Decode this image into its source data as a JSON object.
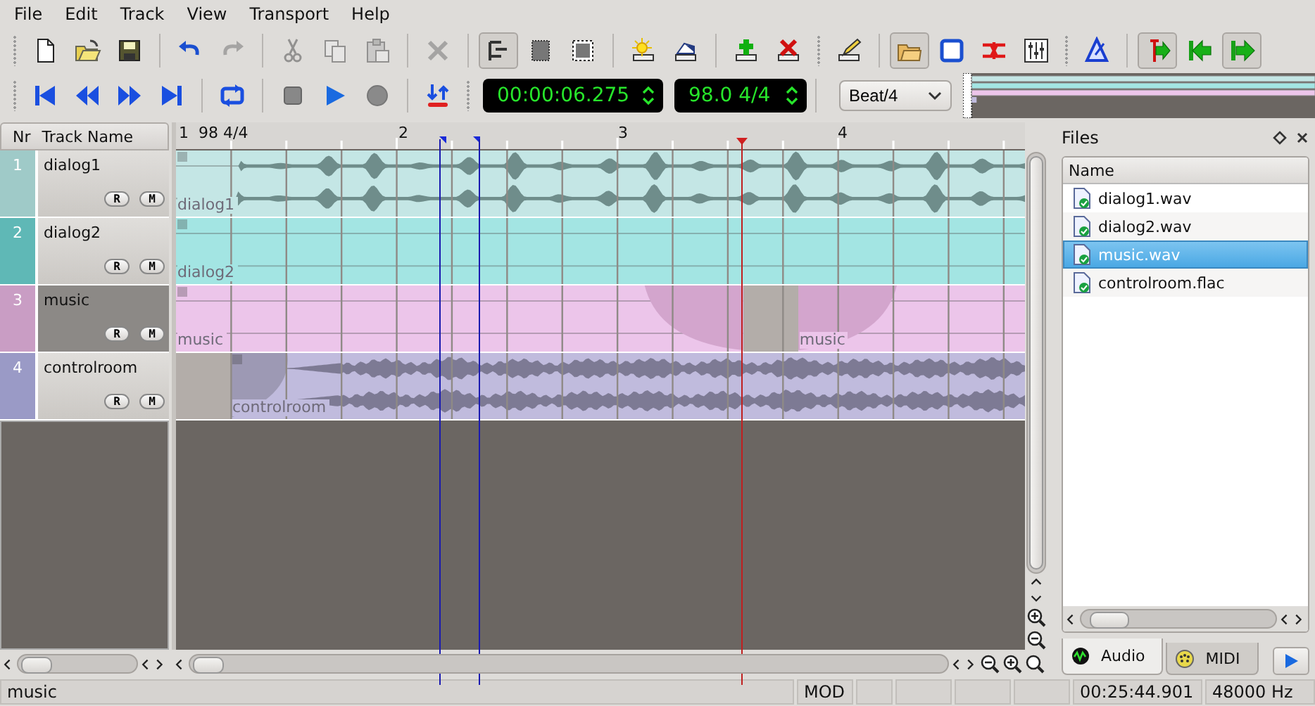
{
  "menu": [
    {
      "label": "File"
    },
    {
      "label": "Edit"
    },
    {
      "label": "Track"
    },
    {
      "label": "View"
    },
    {
      "label": "Transport"
    },
    {
      "label": "Help"
    }
  ],
  "toolbar": {
    "tools": [
      {
        "pressed": false,
        "disabled": false
      },
      {
        "pressed": false,
        "disabled": false
      },
      {
        "pressed": false,
        "disabled": false
      },
      {
        "pressed": false,
        "disabled": false
      },
      {
        "pressed": false,
        "disabled": true
      },
      {
        "pressed": false,
        "disabled": true
      },
      {
        "pressed": false,
        "disabled": true
      },
      {
        "pressed": false,
        "disabled": true
      },
      {
        "pressed": false,
        "disabled": true
      },
      {
        "pressed": true,
        "disabled": false
      },
      {
        "pressed": false,
        "disabled": false
      },
      {
        "pressed": false,
        "disabled": false
      },
      {
        "pressed": false,
        "disabled": false
      },
      {
        "pressed": false,
        "disabled": false
      },
      {
        "pressed": false,
        "disabled": false
      },
      {
        "pressed": false,
        "disabled": false
      },
      {
        "pressed": false,
        "disabled": false
      },
      {
        "pressed": true,
        "disabled": false
      },
      {
        "pressed": false,
        "disabled": false
      },
      {
        "pressed": false,
        "disabled": false
      },
      {
        "pressed": false,
        "disabled": false
      },
      {
        "pressed": false,
        "disabled": false
      },
      {
        "pressed": true,
        "disabled": false
      },
      {
        "pressed": false,
        "disabled": false
      },
      {
        "pressed": true,
        "disabled": false
      }
    ]
  },
  "transport": {
    "time": "00:00:06.275",
    "tempo": "98.0 4/4",
    "snap": "Beat/4"
  },
  "track_list": {
    "columns": [
      "Nr",
      "Track Name"
    ],
    "items": [
      {
        "nr": "1",
        "name": "dialog1",
        "selected": false,
        "color": "#9fcac8",
        "buttons": [
          "R",
          "M"
        ],
        "clips": [
          {
            "label": "dialog1",
            "kind": "speech",
            "color": "#c4e6e5"
          }
        ]
      },
      {
        "nr": "2",
        "name": "dialog2",
        "selected": false,
        "color": "#5fb8b6",
        "buttons": [
          "R",
          "M"
        ],
        "clips": [
          {
            "label": "dialog2",
            "kind": "silent",
            "color": "#a3e5e3"
          }
        ]
      },
      {
        "nr": "3",
        "name": "music",
        "selected": true,
        "color": "#c99dc4",
        "buttons": [
          "R",
          "M"
        ],
        "clips": [
          {
            "label": "music",
            "kind": "fade-out",
            "color": "#ecc5ea"
          },
          {
            "label": "music",
            "kind": "fade-in",
            "color": "#ecc5ea"
          }
        ]
      },
      {
        "nr": "4",
        "name": "controlroom",
        "selected": false,
        "color": "#9a9ac6",
        "buttons": [
          "R",
          "M"
        ],
        "clips": [
          {
            "label": "controlroom",
            "kind": "dense",
            "color": "#c0bbdd"
          }
        ]
      }
    ]
  },
  "ruler": {
    "first_bar": "1",
    "meter": "98 4/4",
    "bars": [
      "2",
      "3",
      "4"
    ]
  },
  "files": {
    "title": "Files",
    "column": "Name",
    "items": [
      {
        "name": "dialog1.wav",
        "selected": false
      },
      {
        "name": "dialog2.wav",
        "selected": false
      },
      {
        "name": "music.wav",
        "selected": true
      },
      {
        "name": "controlroom.flac",
        "selected": false
      }
    ],
    "tabs": [
      {
        "label": "Audio",
        "selected": true
      },
      {
        "label": "MIDI",
        "selected": false
      }
    ]
  },
  "status_bar": {
    "track": "music",
    "mode": "MOD",
    "time": "00:25:44.901",
    "rate": "48000 Hz"
  }
}
